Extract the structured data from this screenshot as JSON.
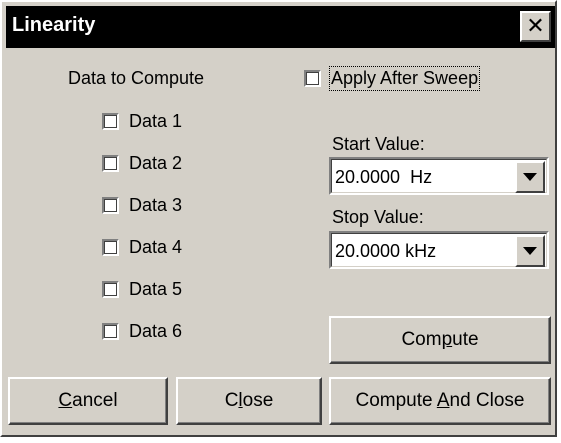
{
  "window": {
    "title": "Linearity",
    "close_glyph": "✕"
  },
  "data_group": {
    "heading": "Data to Compute",
    "items": [
      {
        "label": "Data 1",
        "checked": false
      },
      {
        "label": "Data 2",
        "checked": false
      },
      {
        "label": "Data 3",
        "checked": false
      },
      {
        "label": "Data 4",
        "checked": false
      },
      {
        "label": "Data 5",
        "checked": false
      },
      {
        "label": "Data 6",
        "checked": false
      }
    ]
  },
  "apply_after_sweep": {
    "label": "Apply After Sweep",
    "checked": false
  },
  "start": {
    "label": "Start Value:",
    "value": "20.0000  Hz"
  },
  "stop": {
    "label": "Stop Value:",
    "value": "20.0000 kHz"
  },
  "buttons": {
    "compute": {
      "pre": "Com",
      "mnemonic": "p",
      "post": "ute"
    },
    "cancel": {
      "pre": "",
      "mnemonic": "C",
      "post": "ancel"
    },
    "close": {
      "pre": "C",
      "mnemonic": "l",
      "post": "ose"
    },
    "compute_and_close": {
      "pre": "Compute ",
      "mnemonic": "A",
      "post": "nd Close"
    }
  },
  "icons": {
    "close": "close-icon",
    "dropdown": "chevron-down-icon"
  },
  "colors": {
    "title_bar": "#000000",
    "title_text": "#ffffff",
    "dialog_face": "#d4d0c8"
  }
}
